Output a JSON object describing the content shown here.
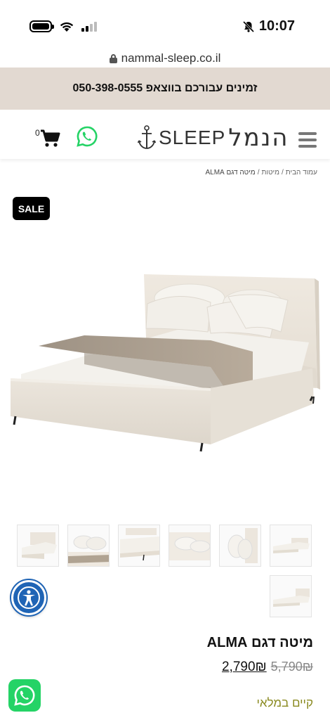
{
  "status_bar": {
    "time": "10:07",
    "battery_level": 1.0
  },
  "browser": {
    "url": "nammal-sleep.co.il"
  },
  "promo_banner": {
    "text": "זמינים עבורכם בווצאפ 050-398-0555"
  },
  "header": {
    "logo_latin": "SLEEP",
    "logo_hebrew": "הנמל",
    "cart_count": "0",
    "icons": {
      "cart": "cart-icon",
      "whatsapp": "whatsapp-icon",
      "menu": "hamburger-menu-icon",
      "logo_anchor": "anchor-icon"
    }
  },
  "breadcrumb": {
    "items": [
      "עמוד הבית",
      "מיטות",
      "מיטה דגם ALMA"
    ],
    "separator": "/"
  },
  "product": {
    "badge": "SALE",
    "title": "מיטה דגם ALMA",
    "price_old": "5,790₪",
    "price_new": "2,790₪",
    "stock_status": "קיים במלאי",
    "thumbnails_count": 7
  },
  "colors": {
    "promo_bg": "#e2d9d1",
    "whatsapp_green": "#25d366",
    "accessibility_blue": "#1f64b5",
    "stock_color": "#8a8a20"
  }
}
